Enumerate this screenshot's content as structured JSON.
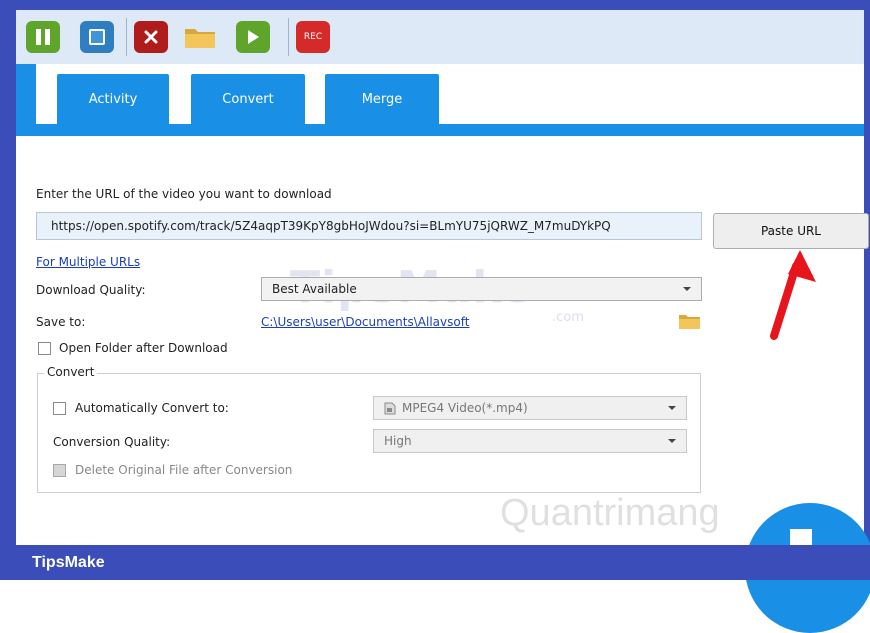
{
  "toolbar": {
    "buttons": [
      {
        "icon": "pause-icon",
        "color": "#5fa52c"
      },
      {
        "icon": "stop-icon",
        "color": "#2f7fc0"
      },
      {
        "icon": "close-icon",
        "color": "#b01c1c"
      },
      {
        "icon": "folder-icon",
        "color": "#e6b84a"
      },
      {
        "icon": "play-icon",
        "color": "#5fa52c"
      },
      {
        "icon": "record-icon",
        "color": "#d42a2a"
      }
    ],
    "rec_label": "REC"
  },
  "tabs": [
    {
      "label": "Activity"
    },
    {
      "label": "Convert"
    },
    {
      "label": "Merge"
    }
  ],
  "form": {
    "url_prompt": "Enter the URL of the video you want to download",
    "url_value": "https://open.spotify.com/track/5Z4aqpT39KpY8gbHoJWdou?si=BLmYU75jQRWZ_M7muDYkPQ",
    "paste_button": "Paste URL",
    "multiple_urls_link": "For Multiple URLs",
    "quality_label": "Download Quality:",
    "quality_value": "Best Available",
    "save_label": "Save to:",
    "save_path": "C:\\Users\\user\\Documents\\Allavsoft",
    "open_folder_label": "Open Folder after Download"
  },
  "convert_group": {
    "title": "Convert",
    "auto_convert_label": "Automatically Convert to:",
    "format_value": "MPEG4 Video(*.mp4)",
    "quality_label": "Conversion Quality:",
    "quality_value": "High",
    "delete_original_label": "Delete Original File after Conversion"
  },
  "watermark": {
    "text": "TipsMake",
    "suffix": ".com",
    "bottom_text": "Quantrimang"
  },
  "footer": {
    "brand": "TipsMake"
  },
  "colors": {
    "accent": "#1a8fe6",
    "frame": "#3a4db8",
    "arrow": "#e8141c"
  }
}
